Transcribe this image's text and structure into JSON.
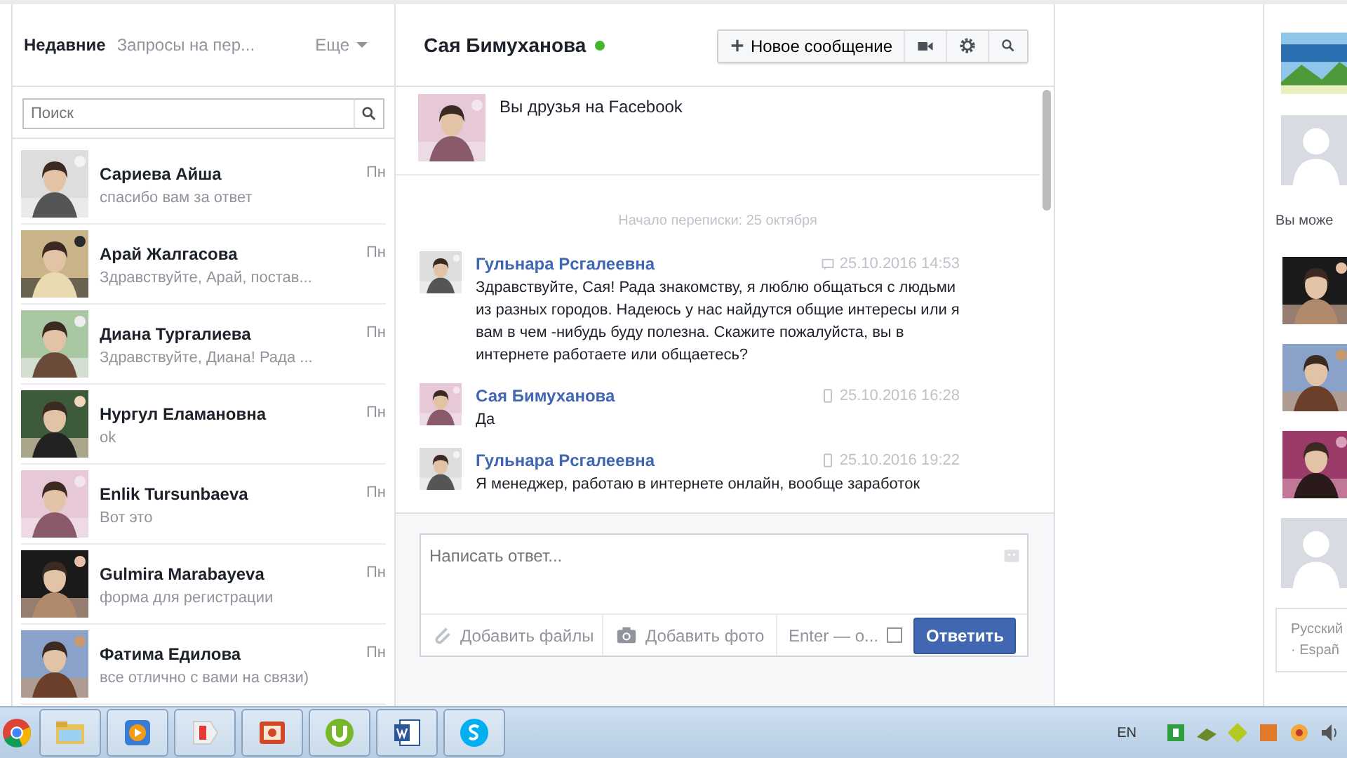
{
  "tabs": [
    {
      "label": "Недавние",
      "selected": true
    },
    {
      "label": "Запросы на пер...",
      "selected": false
    }
  ],
  "more_menu": {
    "label": "Еще"
  },
  "search": {
    "placeholder": "Поиск"
  },
  "conversations": [
    {
      "name": "Сариева Айша",
      "snippet": "спасибо вам за ответ",
      "time": "Пн"
    },
    {
      "name": "Арай Жалгасова",
      "snippet": "Здравствуйте, Арай, постав...",
      "time": "Пн"
    },
    {
      "name": "Диана Тургалиева",
      "snippet": "Здравствуйте, Диана! Рада ...",
      "time": "Пн"
    },
    {
      "name": "Нургул Еламановна",
      "snippet": "ok",
      "time": "Пн"
    },
    {
      "name": "Enlik Tursunbaeva",
      "snippet": "Вот это",
      "time": "Пн"
    },
    {
      "name": "Gulmira Marabayeva",
      "snippet": "форма для регистрации",
      "time": "Пн"
    },
    {
      "name": "Фатима Едилова",
      "snippet": "все отлично с вами на связи)",
      "time": "Пн"
    }
  ],
  "chat": {
    "title": "Сая Бимуханова",
    "online": true,
    "new_message": "Новое сообщение",
    "friend_notice": "Вы друзья на Facebook",
    "start_label": "Начало переписки: 25 октября",
    "messages": [
      {
        "author": "Гульнара Рсгалеевна",
        "kind": "web",
        "time": "25.10.2016 14:53",
        "text": "Здравствуйте, Сая! Рада знакомству, я люблю общаться с людьми из разных городов. Надеюсь у нас найдутся общие интересы или я вам в чем -нибудь буду полезна. Скажите пожалуйста, вы в интернете работаете или общаетесь?"
      },
      {
        "author": "Сая Бимуханова",
        "kind": "mobile",
        "time": "25.10.2016 16:28",
        "text": "Да"
      },
      {
        "author": "Гульнара Рсгалеевна",
        "kind": "mobile",
        "time": "25.10.2016 19:22",
        "text": "Я менеджер, работаю в интернете онлайн, вообще заработок"
      }
    ],
    "composer": {
      "placeholder": "Написать ответ...",
      "attach": "Добавить файлы",
      "photo": "Добавить фото",
      "enter_label": "Enter — o...",
      "enter_checked": false,
      "send": "Ответить"
    }
  },
  "right_column": {
    "suggest_label": "Вы може",
    "languages": "Русский",
    "languages_2": "· Españ"
  },
  "taskbar": {
    "language": "EN"
  }
}
